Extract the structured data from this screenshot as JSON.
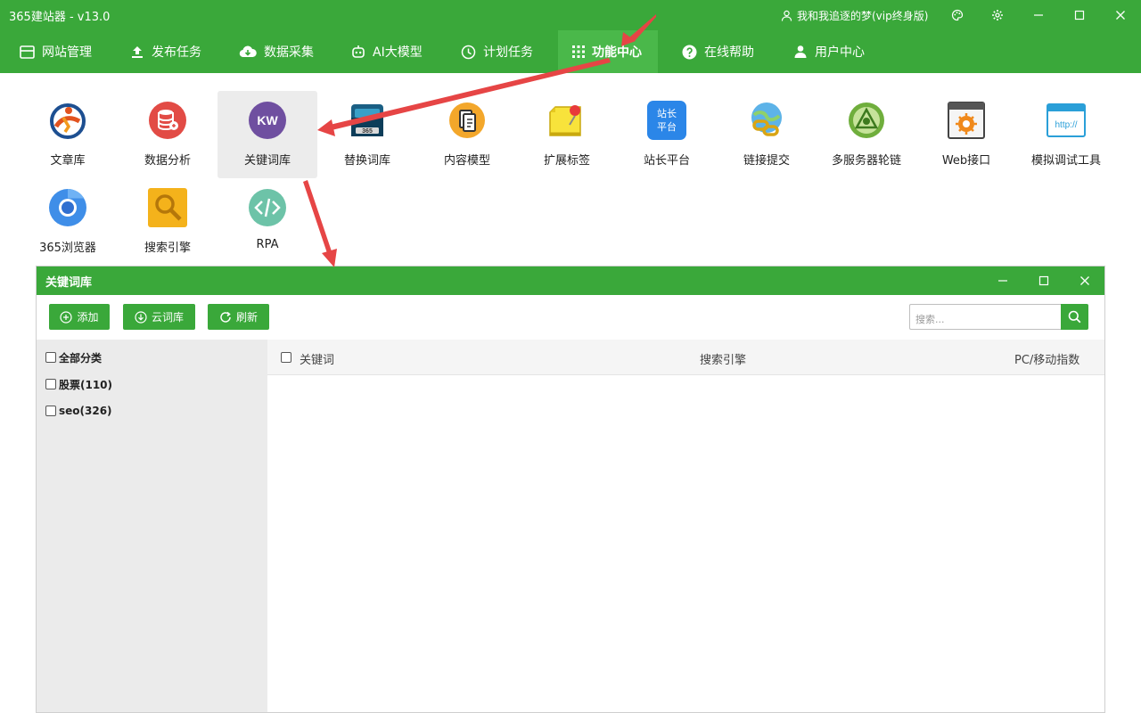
{
  "app": {
    "title": "365建站器 - v13.0",
    "user": "我和我追逐的梦(vip终身版)"
  },
  "colors": {
    "brand": "#3aa83a",
    "arrow": "#e64545"
  },
  "nav": [
    {
      "label": "网站管理",
      "icon": "layout-icon"
    },
    {
      "label": "发布任务",
      "icon": "upload-icon"
    },
    {
      "label": "数据采集",
      "icon": "cloud-download-icon"
    },
    {
      "label": "AI大模型",
      "icon": "robot-icon"
    },
    {
      "label": "计划任务",
      "icon": "clock-icon"
    },
    {
      "label": "功能中心",
      "icon": "grid-icon",
      "active": true
    },
    {
      "label": "在线帮助",
      "icon": "help-icon"
    },
    {
      "label": "用户中心",
      "icon": "user-icon"
    }
  ],
  "functions": [
    {
      "label": "文章库",
      "icon": "article-library-icon"
    },
    {
      "label": "数据分析",
      "icon": "database-icon"
    },
    {
      "label": "关键词库",
      "icon": "kw-icon",
      "badge": "KW",
      "selected": true
    },
    {
      "label": "替换词库",
      "icon": "replace-library-icon",
      "badge": "365"
    },
    {
      "label": "内容模型",
      "icon": "content-model-icon"
    },
    {
      "label": "扩展标签",
      "icon": "tag-pin-icon"
    },
    {
      "label": "站长平台",
      "icon": "webmaster-icon",
      "badge_line1": "站长",
      "badge_line2": "平台"
    },
    {
      "label": "链接提交",
      "icon": "link-submit-icon"
    },
    {
      "label": "多服务器轮链",
      "icon": "multi-server-icon"
    },
    {
      "label": "Web接口",
      "icon": "web-api-icon"
    },
    {
      "label": "模拟调试工具",
      "icon": "http-debug-icon",
      "badge": "http://"
    },
    {
      "label": "365浏览器",
      "icon": "browser-icon"
    },
    {
      "label": "搜索引擎",
      "icon": "search-engine-icon"
    },
    {
      "label": "RPA",
      "icon": "code-icon"
    }
  ],
  "dialog": {
    "title": "关键词库",
    "buttons": [
      {
        "label": "添加",
        "icon": "plus-circle-icon"
      },
      {
        "label": "云词库",
        "icon": "download-circle-icon"
      },
      {
        "label": "刷新",
        "icon": "refresh-icon"
      }
    ],
    "search_placeholder": "搜索...",
    "categories": [
      {
        "label": "全部分类"
      },
      {
        "label": "股票(110)"
      },
      {
        "label": "seo(326)"
      }
    ],
    "columns": [
      "关键词",
      "搜索引擎",
      "PC/移动指数"
    ]
  }
}
